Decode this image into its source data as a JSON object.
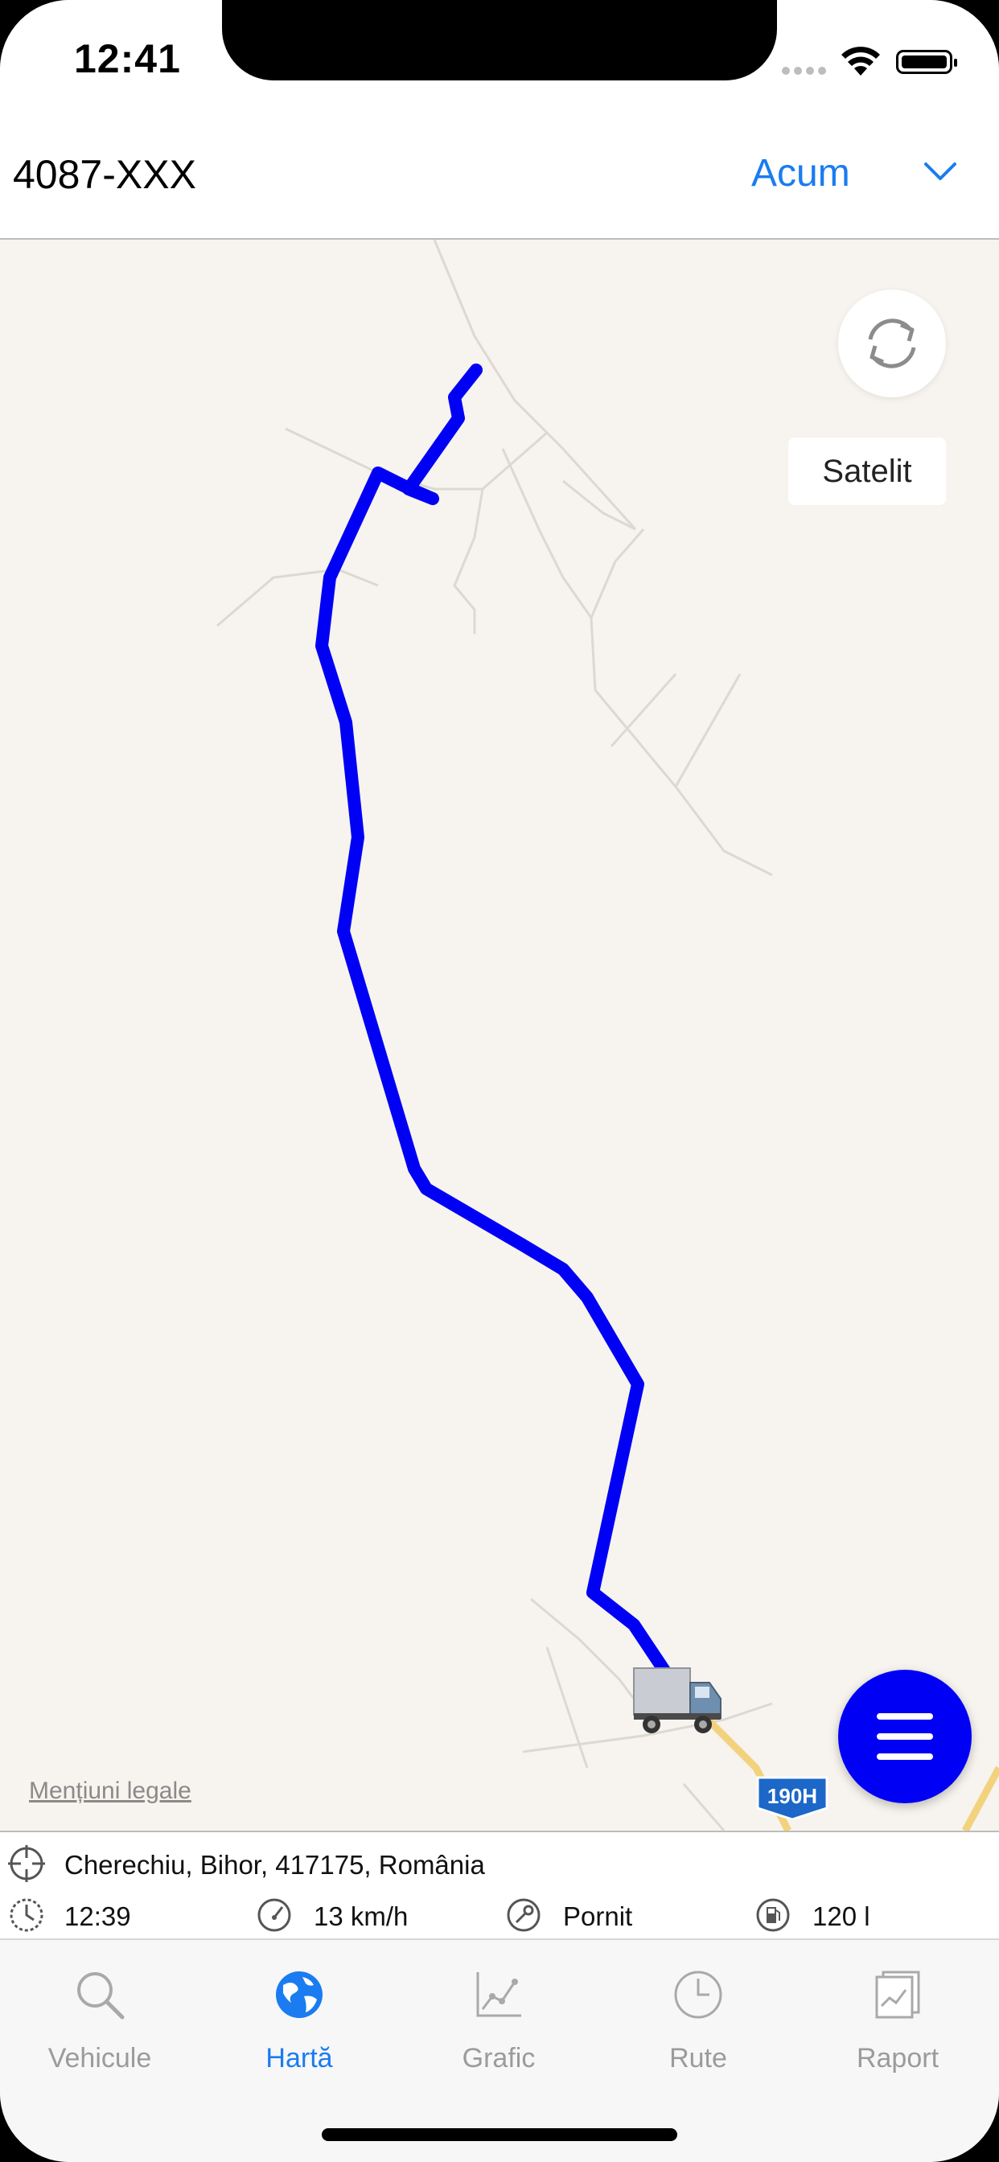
{
  "status_bar": {
    "time": "12:41"
  },
  "header": {
    "vehicle_id": "4087-XXX",
    "period_label": "Acum"
  },
  "map": {
    "satellite_label": "Satelit",
    "legal_link": "Mențiuni legale",
    "route_shield": "190H",
    "route_color": "#0000f5"
  },
  "info": {
    "address": "Cherechiu, Bihor, 417175, România",
    "time": "12:39",
    "speed": "13 km/h",
    "ignition": "Pornit",
    "fuel": "120 l"
  },
  "tabs": [
    {
      "label": "Vehicule",
      "icon": "search-icon"
    },
    {
      "label": "Hartă",
      "icon": "globe-icon",
      "active": true
    },
    {
      "label": "Grafic",
      "icon": "chart-icon"
    },
    {
      "label": "Rute",
      "icon": "clock-icon"
    },
    {
      "label": "Raport",
      "icon": "report-icon"
    }
  ],
  "colors": {
    "accent": "#1a7cf0",
    "route": "#0000f5",
    "map_bg": "#f7f3ee"
  }
}
